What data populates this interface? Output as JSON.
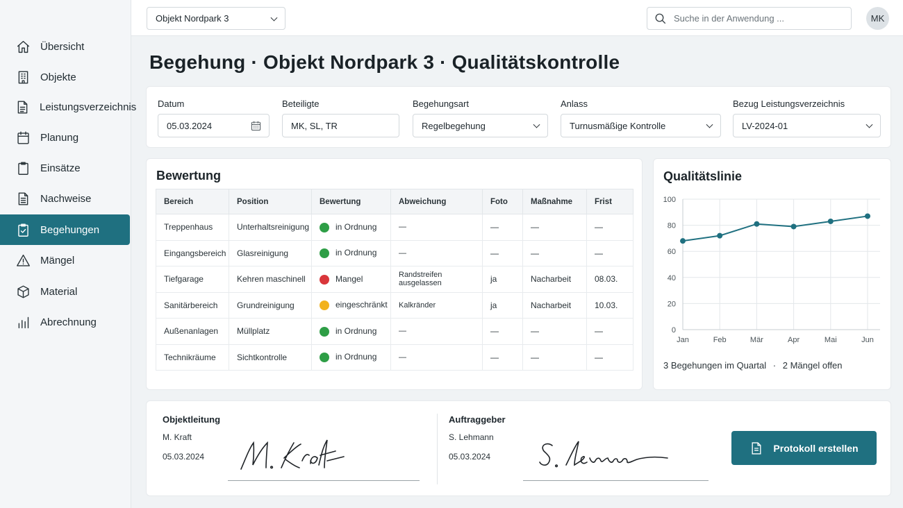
{
  "sidebar": {
    "items": [
      {
        "label": "Übersicht",
        "icon": "home-icon"
      },
      {
        "label": "Objekte",
        "icon": "building-icon"
      },
      {
        "label": "Leistungsverzeichnis",
        "icon": "document-icon"
      },
      {
        "label": "Planung",
        "icon": "calendar-icon"
      },
      {
        "label": "Einsätze",
        "icon": "clipboard-icon"
      },
      {
        "label": "Nachweise",
        "icon": "file-text-icon"
      },
      {
        "label": "Begehungen",
        "icon": "clipboard-check-icon"
      },
      {
        "label": "Mängel",
        "icon": "warning-icon"
      },
      {
        "label": "Material",
        "icon": "box-icon"
      },
      {
        "label": "Abrechnung",
        "icon": "bar-chart-icon"
      }
    ],
    "active_index": 6
  },
  "topbar": {
    "object_select": "Objekt Nordpark 3",
    "search_placeholder": "Suche in der Anwendung ...",
    "avatar": "MK"
  },
  "page": {
    "title": "Begehung · Objekt Nordpark 3 · Qualitätskontrolle"
  },
  "form": {
    "datum_label": "Datum",
    "datum_value": "05.03.2024",
    "beteiligte_label": "Beteiligte",
    "beteiligte_value": "MK, SL, TR",
    "begehungsart_label": "Begehungsart",
    "begehungsart_value": "Regelbegehung",
    "anlass_label": "Anlass",
    "anlass_value": "Turnusmäßige Kontrolle",
    "bezug_label": "Bezug Leistungsverzeichnis",
    "bezug_value": "LV-2024-01"
  },
  "bewertung": {
    "title": "Bewertung",
    "columns": [
      "Bereich",
      "Position",
      "Bewertung",
      "Abweichung",
      "Foto",
      "Maßnahme",
      "Frist"
    ],
    "rows": [
      {
        "bereich": "Treppenhaus",
        "position": "Unterhaltsreinigung",
        "status": "in Ordnung",
        "status_color": "#2e9e46",
        "abweichung": "—",
        "foto": "—",
        "massnahme": "—",
        "frist": "—"
      },
      {
        "bereich": "Eingangsbereich",
        "position": "Glasreinigung",
        "status": "in Ordnung",
        "status_color": "#2e9e46",
        "abweichung": "—",
        "foto": "—",
        "massnahme": "—",
        "frist": "—"
      },
      {
        "bereich": "Tiefgarage",
        "position": "Kehren maschinell",
        "status": "Mangel",
        "status_color": "#d9363b",
        "abweichung": "Randstreifen ausgelassen",
        "foto": "ja",
        "massnahme": "Nacharbeit",
        "frist": "08.03."
      },
      {
        "bereich": "Sanitärbereich",
        "position": "Grundreinigung",
        "status": "eingeschränkt",
        "status_color": "#f2b21d",
        "abweichung": "Kalkränder",
        "foto": "ja",
        "massnahme": "Nacharbeit",
        "frist": "10.03."
      },
      {
        "bereich": "Außenanlagen",
        "position": "Müllplatz",
        "status": "in Ordnung",
        "status_color": "#2e9e46",
        "abweichung": "—",
        "foto": "—",
        "massnahme": "—",
        "frist": "—"
      },
      {
        "bereich": "Technikräume",
        "position": "Sichtkontrolle",
        "status": "in Ordnung",
        "status_color": "#2e9e46",
        "abweichung": "—",
        "foto": "—",
        "massnahme": "—",
        "frist": "—"
      }
    ]
  },
  "quality": {
    "title": "Qualitätslinie",
    "summary_begehungen": "3 Begehungen im Quartal",
    "summary_separator": "·",
    "summary_maengel": "2 Mängel offen"
  },
  "chart_data": {
    "type": "line",
    "x": [
      "Jan",
      "Feb",
      "Mär",
      "Apr",
      "Mai",
      "Jun"
    ],
    "series": [
      {
        "values": [
          68,
          72,
          81,
          79,
          83,
          87
        ]
      }
    ],
    "ylim": [
      0,
      100
    ],
    "yticks": [
      0,
      20,
      40,
      60,
      80,
      100
    ],
    "grid": true,
    "line_color": "#1f7080"
  },
  "signatures": {
    "left_title": "Objektleitung",
    "left_name": "M. Kraft",
    "left_date": "05.03.2024",
    "left_signature": "M. Kraft",
    "right_title": "Auftraggeber",
    "right_name": "S. Lehmann",
    "right_date": "05.03.2024",
    "right_signature": "S. Lehmann",
    "button_label": "Protokoll erstellen"
  }
}
